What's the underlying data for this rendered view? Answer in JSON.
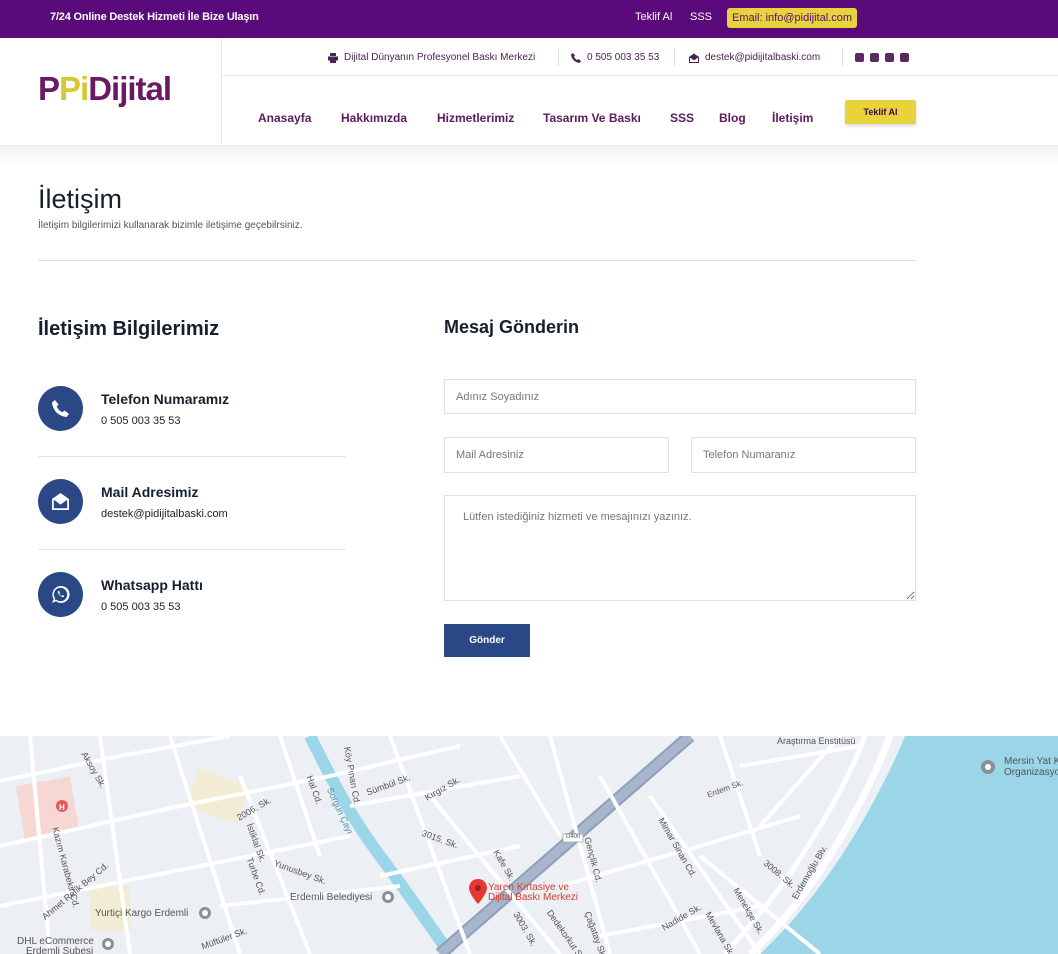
{
  "topbar": {
    "slogan": "7/24 Online Destek Hizmeti İle Bize Ulaşın",
    "links": [
      "Teklif Al",
      "SSS"
    ],
    "email_pill": "Email: info@pidijital.com"
  },
  "logo": {
    "part1": "P",
    "part2": "Pi",
    "part3": "Dijital"
  },
  "infobar": {
    "tagline": "Dijital Dünyanın Profesyonel Baskı Merkezi",
    "phone": "0 505 003 35 53",
    "email": "destek@pidijitalbaski.com"
  },
  "nav": {
    "items": [
      "Anasayfa",
      "Hakkımızda",
      "Hizmetlerimiz",
      "Tasarım Ve Baskı",
      "SSS",
      "Blog",
      "İletişim"
    ],
    "cta": "Teklif Al"
  },
  "page": {
    "title": "İletişim",
    "subtitle": "İletişim bilgilerimizi kullanarak bizimle iletişime geçebilrsiniz."
  },
  "contact_info": {
    "title": "İletişim Bilgilerimiz",
    "items": [
      {
        "label": "Telefon Numaramız",
        "value": "0 505 003 35 53",
        "icon": "phone-icon"
      },
      {
        "label": "Mail Adresimiz",
        "value": "destek@pidijitalbaski.com",
        "icon": "mail-open-icon"
      },
      {
        "label": "Whatsapp Hattı",
        "value": "0 505 003 35 53",
        "icon": "whatsapp-icon"
      }
    ]
  },
  "form": {
    "title": "Mesaj Gönderin",
    "name_placeholder": "Adınız Soyadınız",
    "mail_placeholder": "Mail Adresiniz",
    "phone_placeholder": "Telefon Numaranız",
    "message_placeholder": "Lütfen istediğiniz hizmeti ve mesajınızı yazınız.",
    "submit": "Gönder"
  },
  "map": {
    "pin_label_line1": "Yaren Kırtasiye ve",
    "pin_label_line2": "Dijital Baskı Merkezi",
    "labels": [
      "Kazım Karabekir Cd.",
      "Aksoy Sk.",
      "Ahmet Refik Bey Cd.",
      "İstiklal Sk.",
      "Turbe Cd.",
      "Yunusbey Sk.",
      "Hal Cd.",
      "Köy Pınarı Cd.",
      "Sümbül Sk.",
      "Kırgız Sk.",
      "Sorgun Çayı",
      "3015. Sk.",
      "Kafe Sk.",
      "3003. Sk.",
      "Dedekorkut Sk.",
      "Gençlik Cd.",
      "Çağatay Sk.",
      "Mimar Sinan Cd.",
      "Nadide Sk.",
      "Mevlana Sk.",
      "Menekşe Sk.",
      "3008. Sk.",
      "Erdemoğlu Blv.",
      "Yurtiçi Kargo Erdemli",
      "Erdemli Belediyesi",
      "DHL eCommerce",
      "Erdemli Şubesi",
      "Müftüler Sk.",
      "Araştırma Enstitüsü",
      "Mersin Yat K.",
      "Organizasyo",
      "Erdem Sk.",
      "2006. Sk.",
      "D400"
    ]
  },
  "colors": {
    "purple": "#5a0a7a",
    "yellow": "#e6d43a",
    "blue": "#2a4786",
    "sea": "#9ad5e8"
  }
}
